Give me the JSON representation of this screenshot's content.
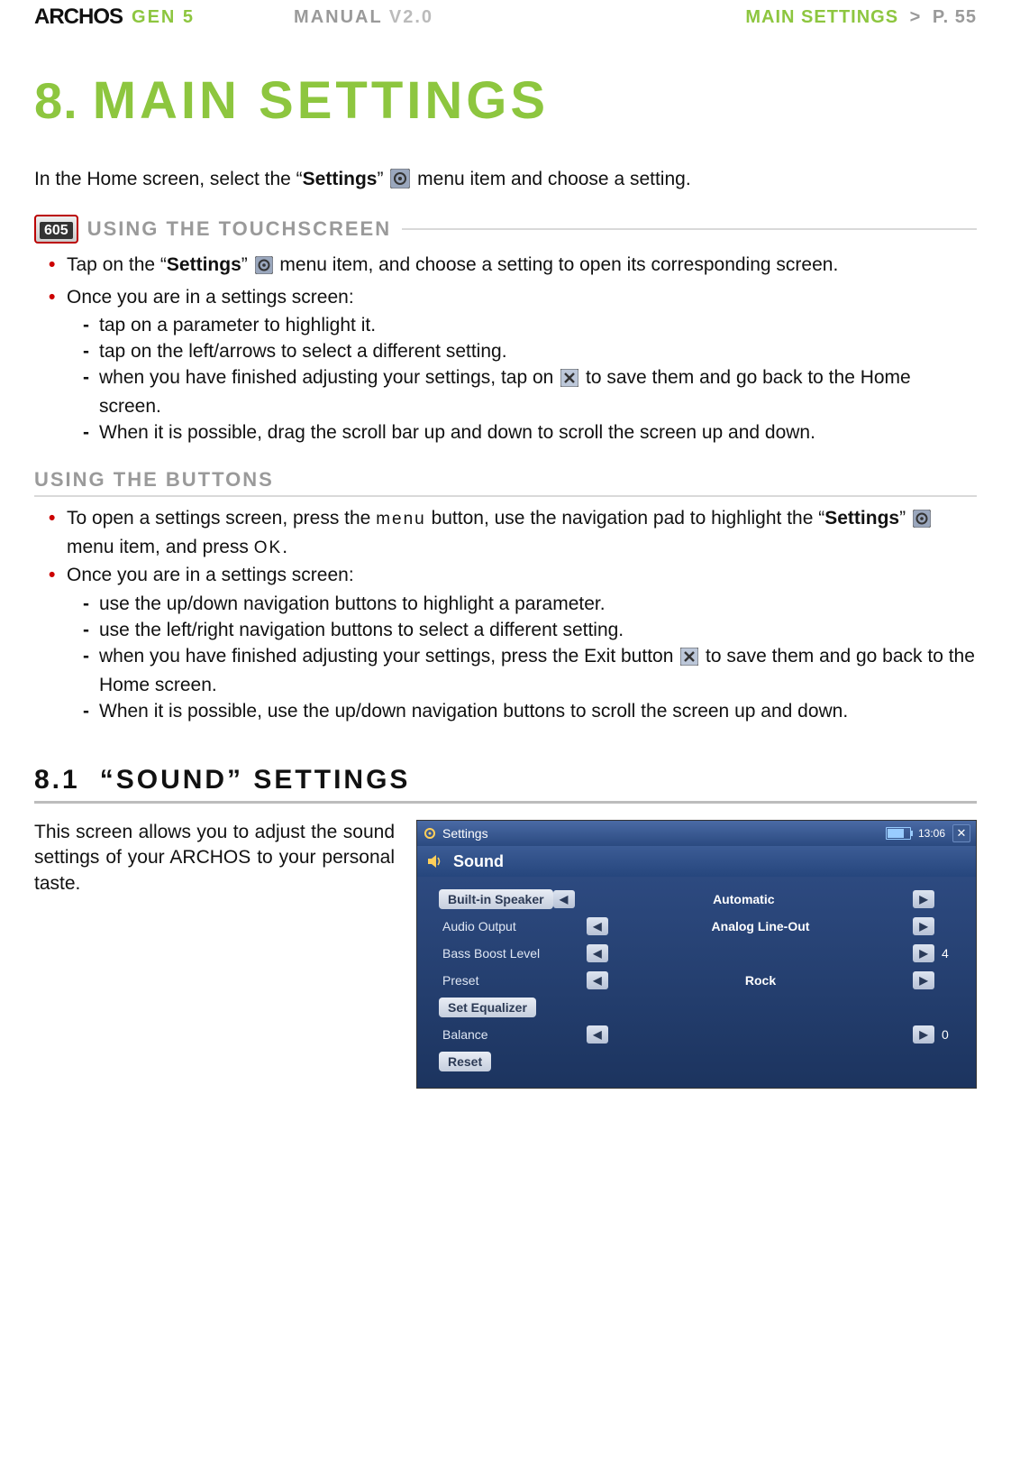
{
  "header": {
    "brand": "ARCHOS",
    "series": "GEN 5",
    "manual": "MANUAL",
    "version": "V2.0",
    "crumb": "MAIN SETTINGS",
    "sep": ">",
    "page": "P. 55"
  },
  "title": {
    "num": "8.",
    "text": "MAIN SETTINGS"
  },
  "intro": {
    "pre": "In the Home screen, select the “",
    "kw": "Settings",
    "post": "” ",
    "tail": " menu item and choose a setting."
  },
  "touch": {
    "badge": "605",
    "label": "USING THE TOUCHSCREEN",
    "b1": {
      "pre": "Tap on the “",
      "kw": "Settings",
      "post": "” ",
      "tail": " menu item, and choose a setting to open its corresponding screen."
    },
    "b2": "Once you are in a settings screen:",
    "d1": "tap on a parameter to highlight it.",
    "d2": "tap on the left/arrows to select a different setting.",
    "d3a": "when you have finished adjusting your settings, tap on ",
    "d3b": " to save them and go back to the Home screen.",
    "d4": "When it is possible, drag the scroll bar up and down to scroll the screen up and down."
  },
  "buttons": {
    "label": "USING THE BUTTONS",
    "b1": {
      "a": "To open a settings screen, press the ",
      "menu": "menu",
      "b": " button, use the navigation pad to highlight the “",
      "kw": "Settings",
      "c": "” ",
      "d": " menu item, and press ",
      "ok": "OK",
      "e": "."
    },
    "b2": "Once you are in a settings screen:",
    "d1": "use the up/down navigation buttons to highlight a parameter.",
    "d2": "use the left/right navigation buttons to select a different setting.",
    "d3a": "when you have finished adjusting your settings, press the Exit button ",
    "d3b": " to save them and go back to the Home screen.",
    "d4": "When it is possible, use the up/down navigation buttons to scroll the screen up and down."
  },
  "sound": {
    "num": "8.1",
    "title": "“SOUND” SETTINGS",
    "para": "This screen allows you to adjust the sound settings of your ARCHOS to your personal taste."
  },
  "shot": {
    "bar_title": "Settings",
    "time": "13:06",
    "title": "Sound",
    "rows": [
      {
        "label": "Built-in Speaker",
        "pill": true,
        "left": true,
        "value": "Automatic",
        "right": true,
        "extra": ""
      },
      {
        "label": "Audio Output",
        "pill": false,
        "left": true,
        "value": "Analog Line-Out",
        "right": true,
        "extra": ""
      },
      {
        "label": "Bass Boost Level",
        "pill": false,
        "left": true,
        "value": "",
        "right": true,
        "extra": "4"
      },
      {
        "label": "Preset",
        "pill": false,
        "left": true,
        "value": "Rock",
        "right": true,
        "extra": ""
      },
      {
        "label": "Set Equalizer",
        "pill": true,
        "left": false,
        "value": "",
        "right": false,
        "extra": ""
      },
      {
        "label": "Balance",
        "pill": false,
        "left": true,
        "value": "",
        "right": true,
        "extra": "0"
      },
      {
        "label": "Reset",
        "pill": true,
        "left": false,
        "value": "",
        "right": false,
        "extra": ""
      }
    ]
  }
}
